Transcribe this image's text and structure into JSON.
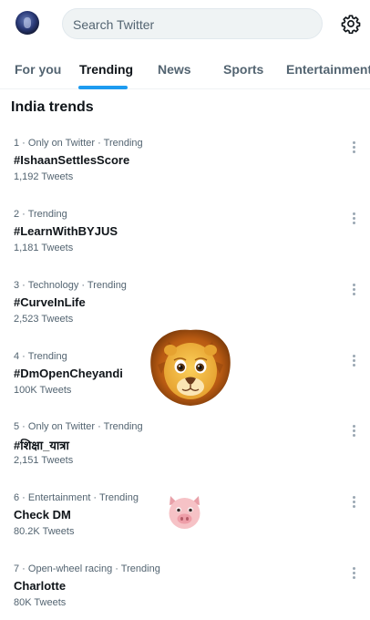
{
  "header": {
    "search_placeholder": "Search Twitter",
    "avatar_icon": "profile-avatar",
    "settings_icon": "gear-icon"
  },
  "tabs": [
    {
      "label": "For you",
      "active": false
    },
    {
      "label": "Trending",
      "active": true
    },
    {
      "label": "News",
      "active": false
    },
    {
      "label": "Sports",
      "active": false
    },
    {
      "label": "Entertainment",
      "active": false
    }
  ],
  "section": {
    "title": "India trends"
  },
  "trends": [
    {
      "meta": "1 · Only on Twitter · Trending",
      "name": "#IshaanSettlesScore",
      "count": "1,192 Tweets"
    },
    {
      "meta": "2 · Trending",
      "name": "#LearnWithBYJUS",
      "count": "1,181 Tweets"
    },
    {
      "meta": "3 · Technology · Trending",
      "name": "#CurveInLife",
      "count": "2,523 Tweets"
    },
    {
      "meta": "4 · Trending",
      "name": "#DmOpenCheyandi",
      "count": "100K Tweets"
    },
    {
      "meta": "5 · Only on Twitter · Trending",
      "name": "#शिक्षा_यात्रा",
      "count": "2,151 Tweets"
    },
    {
      "meta": "6 · Entertainment · Trending",
      "name": "Check DM",
      "count": "80.2K Tweets"
    },
    {
      "meta": "7 · Open-wheel racing · Trending",
      "name": "Charlotte",
      "count": "80K Tweets"
    }
  ],
  "stickers": {
    "lion": "lion-face-sticker",
    "pig": "pig-face-sticker"
  },
  "colors": {
    "accent": "#1d9bf0",
    "text": "#0f1419",
    "secondary": "#536471",
    "search_bg": "#eff3f4"
  }
}
